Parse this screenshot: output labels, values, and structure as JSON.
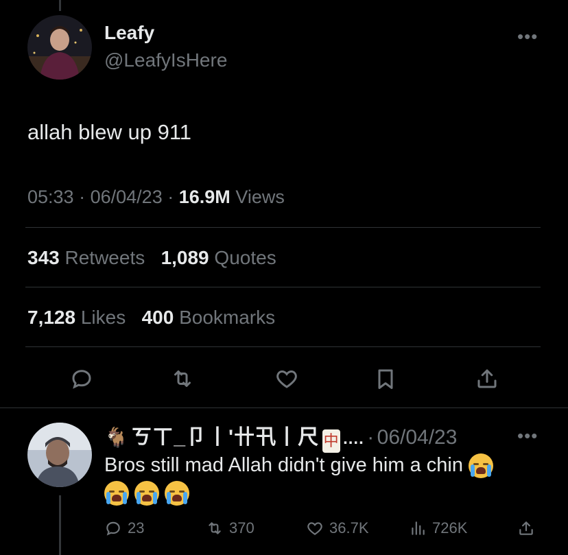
{
  "tweet": {
    "display_name": "Leafy",
    "handle": "@LeafyIsHere",
    "more_label": "•••",
    "text": "allah blew up 911",
    "time": "05:33",
    "sep1": "·",
    "date": "06/04/23",
    "sep2": "·",
    "views_count": "16.9M",
    "views_label": "Views",
    "retweets_count": "343",
    "retweets_label": "Retweets",
    "quotes_count": "1,089",
    "quotes_label": "Quotes",
    "likes_count": "7,128",
    "likes_label": "Likes",
    "bookmarks_count": "400",
    "bookmarks_label": "Bookmarks",
    "actions": [
      "reply-icon",
      "retweet-icon",
      "like-icon",
      "bookmark-icon",
      "share-icon"
    ]
  },
  "reply": {
    "goat_emoji": "🐐",
    "display_name": "ㄎㄒ_卩丨'卄卂丨尺",
    "mahjong_char": "中",
    "ellipsis": "....",
    "sep": "·",
    "date": "06/04/23",
    "more_label": "•••",
    "text": "Bros still mad Allah didn't give him a chin",
    "emoji_name": "loudly-crying-face",
    "reply_count": "23",
    "retweet_count": "370",
    "like_count": "36.7K",
    "views_count": "726K"
  },
  "colors": {
    "background": "#000000",
    "text_primary": "#e7e9ea",
    "text_secondary": "#71767b",
    "divider": "#2f3336"
  }
}
